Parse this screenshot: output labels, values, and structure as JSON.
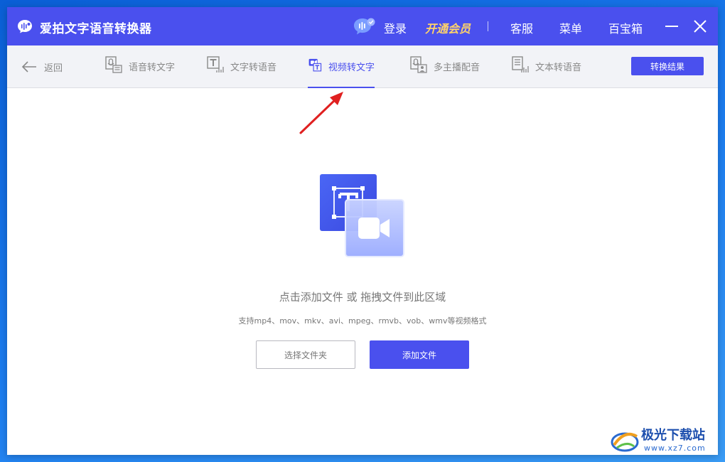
{
  "titlebar": {
    "app_title": "爱拍文字语音转换器",
    "login": "登录",
    "vip": "开通会员",
    "service": "客服",
    "menu": "菜单",
    "toolbox": "百宝箱"
  },
  "tabs": {
    "back": "返回",
    "items": [
      {
        "label": "语音转文字",
        "icon": "mic-doc-icon"
      },
      {
        "label": "文字转语音",
        "icon": "text-t-icon"
      },
      {
        "label": "视频转文字",
        "icon": "video-text-icon",
        "active": true
      },
      {
        "label": "多主播配音",
        "icon": "person-dub-icon"
      },
      {
        "label": "文本转语音",
        "icon": "doc-audio-icon"
      }
    ],
    "result_button": "转换结果"
  },
  "main": {
    "hint": "点击添加文件 或 拖拽文件到此区域",
    "formats": "支持mp4、mov、mkv、avi、mpeg、rmvb、vob、wmv等视频格式",
    "select_folder": "选择文件夹",
    "add_file": "添加文件"
  },
  "watermark": {
    "name": "极光下载站",
    "url": "www.xz7.com"
  },
  "colors": {
    "accent": "#4a50ee",
    "vip": "#ffd36a",
    "arrow": "#e02020"
  }
}
